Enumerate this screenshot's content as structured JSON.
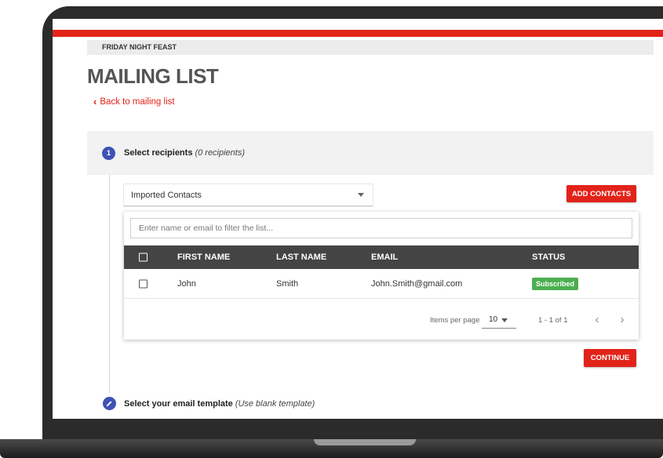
{
  "brand": "FRIDAY NIGHT FEAST",
  "page_title": "MAILING LIST",
  "back_link": "Back to mailing list",
  "step1": {
    "number": "1",
    "title": "Select recipients",
    "subtitle": "(0 recipients)"
  },
  "recipients_select": {
    "value": "Imported Contacts"
  },
  "add_contacts_label": "ADD CONTACTS",
  "filter": {
    "placeholder": "Enter name or email to filter the list..."
  },
  "table": {
    "columns": {
      "first_name": "FIRST NAME",
      "last_name": "LAST NAME",
      "email": "EMAIL",
      "status": "STATUS"
    },
    "rows": [
      {
        "first_name": "John",
        "last_name": "Smith",
        "email": "John.Smith@gmail.com",
        "status": "Subscribed"
      }
    ]
  },
  "pagination": {
    "items_per_page_label": "Items per page",
    "items_per_page": "10",
    "range": "1 - 1 of 1",
    "prev": "‹",
    "next": "›"
  },
  "continue_label": "CONTINUE",
  "step2": {
    "title": "Select your email template",
    "subtitle": "(Use blank template)"
  },
  "colors": {
    "accent_red": "#e2231a",
    "step_blue": "#3f51b5",
    "subscribed_green": "#4caf50",
    "table_header": "#444444"
  }
}
